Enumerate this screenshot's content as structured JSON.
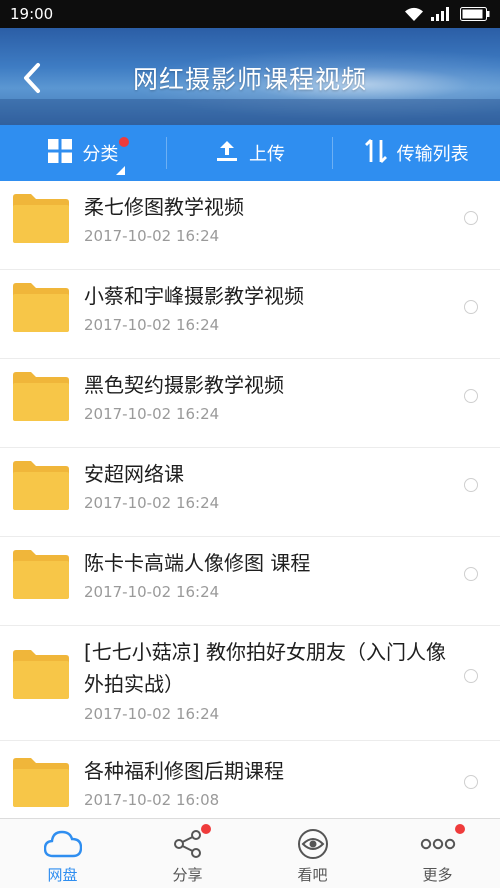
{
  "status_bar": {
    "time": "19:00"
  },
  "header": {
    "title": "网红摄影师课程视频"
  },
  "toolbar": {
    "items": [
      {
        "label": "分类",
        "icon": "grid-icon",
        "has_dot": true
      },
      {
        "label": "上传",
        "icon": "upload-icon"
      },
      {
        "label": "传输列表",
        "icon": "transfer-icon"
      }
    ]
  },
  "files": [
    {
      "name": "柔七修图教学视频",
      "date": "2017-10-02  16:24"
    },
    {
      "name": "小蔡和宇峰摄影教学视频",
      "date": "2017-10-02  16:24"
    },
    {
      "name": "黑色契约摄影教学视频",
      "date": "2017-10-02  16:24"
    },
    {
      "name": "安超网络课",
      "date": "2017-10-02  16:24"
    },
    {
      "name": "陈卡卡高端人像修图  课程",
      "date": "2017-10-02  16:24"
    },
    {
      "name": "[七七小菇凉] 教你拍好女朋友（入门人像外拍实战）",
      "date": "2017-10-02  16:24"
    },
    {
      "name": "各种福利修图后期课程",
      "date": "2017-10-02  16:08"
    }
  ],
  "tabs": [
    {
      "label": "网盘",
      "icon": "cloud-icon",
      "active": true,
      "has_dot": false
    },
    {
      "label": "分享",
      "icon": "share-icon",
      "active": false,
      "has_dot": true
    },
    {
      "label": "看吧",
      "icon": "eye-icon",
      "active": false,
      "has_dot": false
    },
    {
      "label": "更多",
      "icon": "more-icon",
      "active": false,
      "has_dot": true
    }
  ],
  "colors": {
    "accent": "#2f8ef0",
    "folder": "#f7c648",
    "dot": "#ef3b3b"
  }
}
